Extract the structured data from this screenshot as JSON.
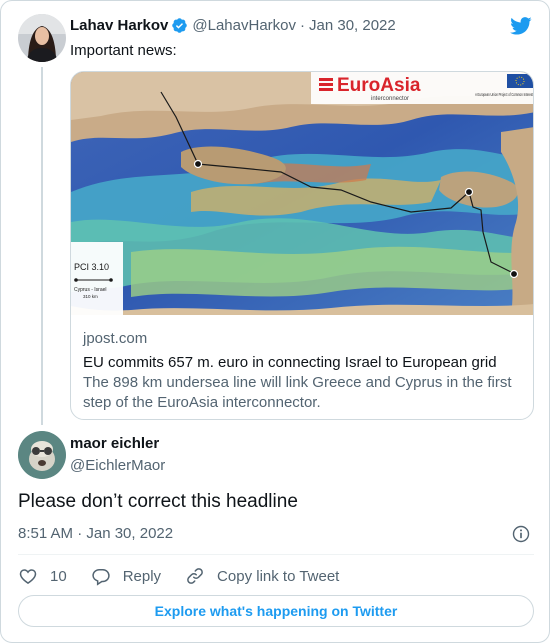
{
  "original_tweet": {
    "author_name": "Lahav Harkov",
    "handle": "@LahavHarkov",
    "date": "Jan 30, 2022",
    "text": "Important news:",
    "link_card": {
      "image_logo_text": "EuroAsia",
      "image_logo_subtext": "interconnector",
      "image_corner_text": "A European Union Project of Common Interest",
      "image_legend_title": "PCI 3.10",
      "image_legend_row": "Cyprus - Israel",
      "image_legend_km": "310 km",
      "domain": "jpost.com",
      "headline": "EU commits 657 m. euro in connecting Israel to European grid",
      "description": "The 898 km undersea line will link Greece and Cyprus in the first step of the EuroAsia interconnector."
    }
  },
  "reply": {
    "author_name": "maor eichler",
    "handle": "@EichlerMaor",
    "text": "Please don’t correct this headline",
    "timestamp": "8:51 AM · Jan 30, 2022"
  },
  "actions": {
    "like_count": "10",
    "reply_label": "Reply",
    "copy_link_label": "Copy link to Tweet"
  },
  "explore_label": "Explore what's happening on Twitter",
  "colors": {
    "accent": "#1d9bf0",
    "text": "#0f1419",
    "muted": "#536471",
    "border": "#cfd9de"
  }
}
